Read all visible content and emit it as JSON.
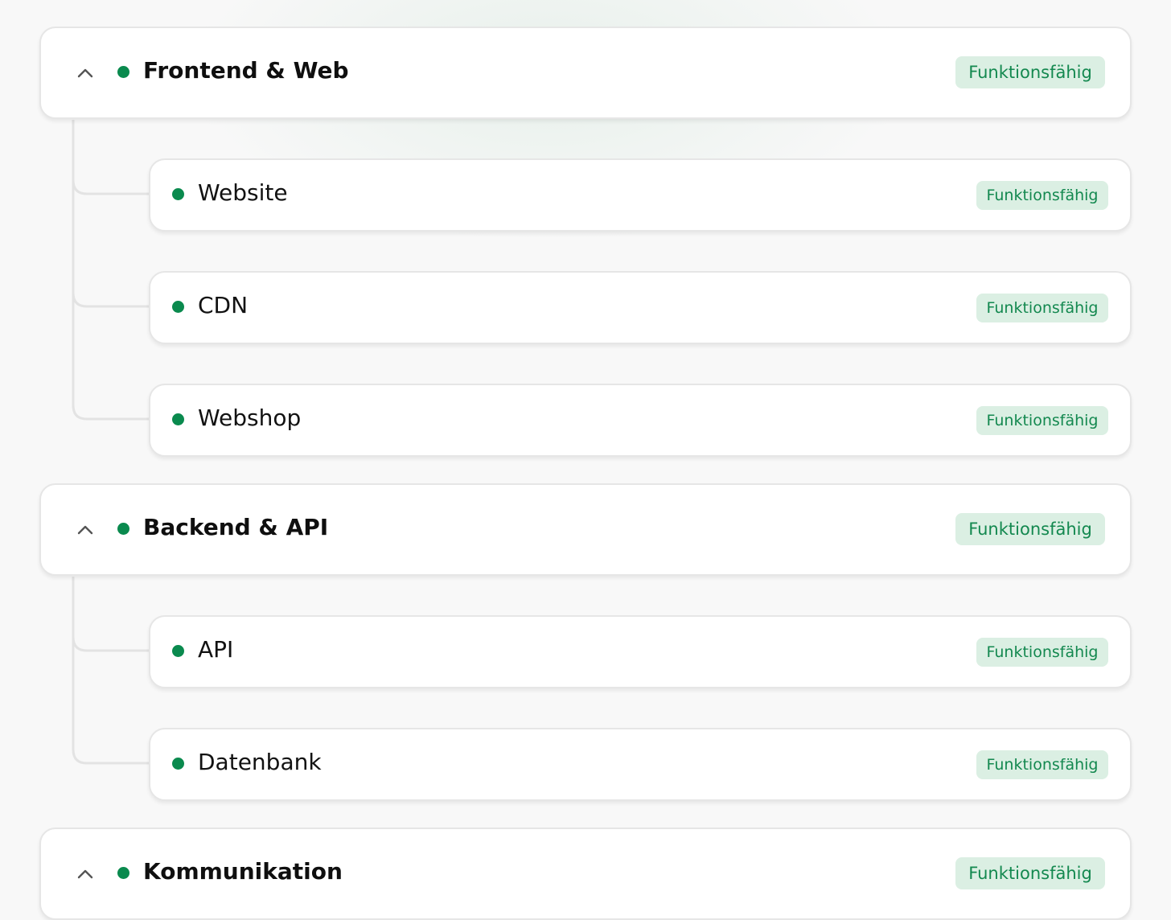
{
  "colors": {
    "status_ok": "#0a8a4e",
    "badge_bg": "#dbefe3",
    "badge_text": "#13884f"
  },
  "groups": [
    {
      "title": "Frontend & Web",
      "status": "Funktionsfähig",
      "expanded": true,
      "services": [
        {
          "name": "Website",
          "status": "Funktionsfähig"
        },
        {
          "name": "CDN",
          "status": "Funktionsfähig"
        },
        {
          "name": "Webshop",
          "status": "Funktionsfähig"
        }
      ]
    },
    {
      "title": "Backend & API",
      "status": "Funktionsfähig",
      "expanded": true,
      "services": [
        {
          "name": "API",
          "status": "Funktionsfähig"
        },
        {
          "name": "Datenbank",
          "status": "Funktionsfähig"
        }
      ]
    },
    {
      "title": "Kommunikation",
      "status": "Funktionsfähig",
      "expanded": true,
      "services": []
    }
  ]
}
